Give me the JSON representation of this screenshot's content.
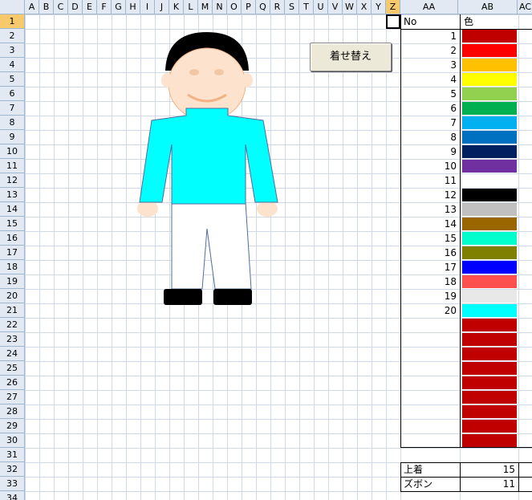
{
  "columns": [
    "A",
    "B",
    "C",
    "D",
    "E",
    "F",
    "G",
    "H",
    "I",
    "J",
    "K",
    "L",
    "M",
    "N",
    "O",
    "P",
    "Q",
    "R",
    "S",
    "T",
    "U",
    "V",
    "W",
    "X",
    "Y",
    "Z",
    "AA",
    "AB",
    "AC"
  ],
  "selected_column": "Z",
  "rows": [
    "1",
    "2",
    "3",
    "4",
    "5",
    "6",
    "7",
    "8",
    "9",
    "10",
    "11",
    "12",
    "13",
    "14",
    "15",
    "16",
    "17",
    "18",
    "19",
    "20",
    "21",
    "22",
    "23",
    "24",
    "25",
    "26",
    "27",
    "28",
    "29",
    "30",
    "31",
    "32",
    "33",
    "34"
  ],
  "selected_row": "1",
  "button": {
    "label": "着せ替え"
  },
  "table": {
    "header_no": "No",
    "header_color": "色",
    "entries": [
      {
        "no": "1",
        "color": "#c00000"
      },
      {
        "no": "2",
        "color": "#ff0000"
      },
      {
        "no": "3",
        "color": "#ffc000"
      },
      {
        "no": "4",
        "color": "#ffff00"
      },
      {
        "no": "5",
        "color": "#92d050"
      },
      {
        "no": "6",
        "color": "#00b050"
      },
      {
        "no": "7",
        "color": "#00b0f0"
      },
      {
        "no": "8",
        "color": "#0070c0"
      },
      {
        "no": "9",
        "color": "#002060"
      },
      {
        "no": "10",
        "color": "#7030a0"
      },
      {
        "no": "11",
        "color": "#ffffff"
      },
      {
        "no": "12",
        "color": "#000000"
      },
      {
        "no": "13",
        "color": "#c0c0c0"
      },
      {
        "no": "14",
        "color": "#996600"
      },
      {
        "no": "15",
        "color": "#00ffcc"
      },
      {
        "no": "16",
        "color": "#808000"
      },
      {
        "no": "17",
        "color": "#0000ff"
      },
      {
        "no": "18",
        "color": "#ff5050"
      },
      {
        "no": "19",
        "color": "#e8e8e8"
      },
      {
        "no": "20",
        "color": "#00ffff"
      },
      {
        "no": "",
        "color": "#c00000"
      },
      {
        "no": "",
        "color": "#c00000"
      },
      {
        "no": "",
        "color": "#c00000"
      },
      {
        "no": "",
        "color": "#c00000"
      },
      {
        "no": "",
        "color": "#c00000"
      },
      {
        "no": "",
        "color": "#c00000"
      },
      {
        "no": "",
        "color": "#c00000"
      },
      {
        "no": "",
        "color": "#c00000"
      },
      {
        "no": "",
        "color": "#c00000"
      }
    ]
  },
  "summary": {
    "top_label": "上着",
    "top_value": "15",
    "pants_label": "ズボン",
    "pants_value": "11"
  },
  "figure": {
    "shirt_color": "#00ffff",
    "pants_color": "#ffffff",
    "skin_color": "#fde3cd",
    "hair_color": "#000000",
    "shoe_color": "#000000"
  }
}
